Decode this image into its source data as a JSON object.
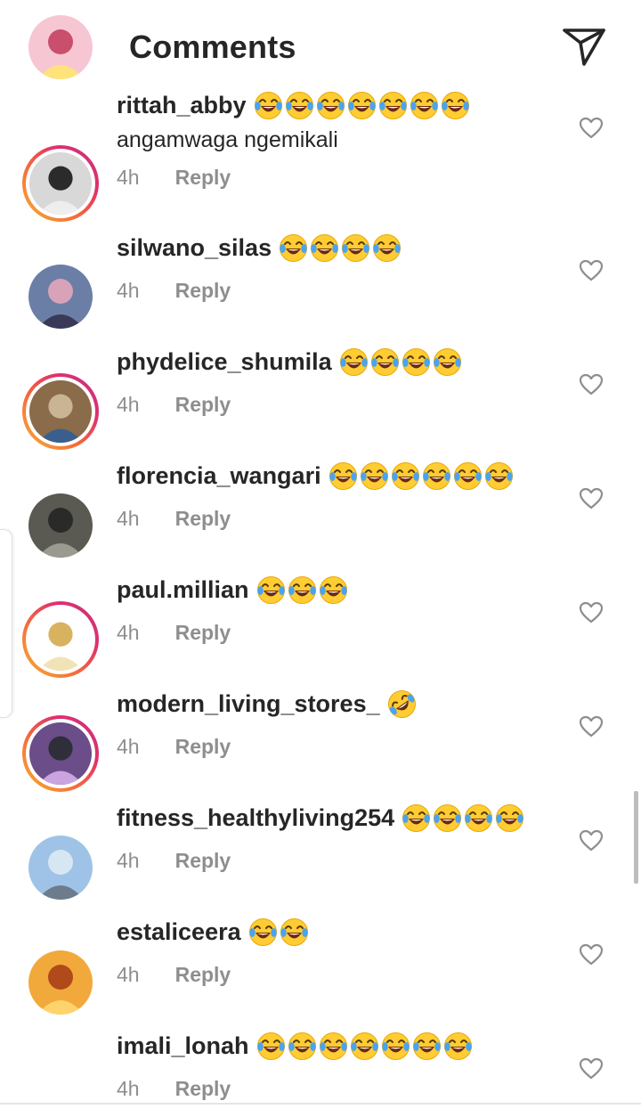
{
  "header": {
    "title": "Comments",
    "back_icon": "arrow-left-icon",
    "send_icon": "paper-plane-icon"
  },
  "comments": [
    {
      "username": "rittah_abby",
      "emoji": "😂",
      "emoji_count": 7,
      "text": "angamwaga ngemikali",
      "time": "4h",
      "reply": "Reply",
      "story_ring": false
    },
    {
      "username": "silwano_silas",
      "emoji": "😂",
      "emoji_count": 4,
      "text": "",
      "time": "4h",
      "reply": "Reply",
      "story_ring": true
    },
    {
      "username": "phydelice_shumila",
      "emoji": "😂",
      "emoji_count": 4,
      "text": "",
      "time": "4h",
      "reply": "Reply",
      "story_ring": false
    },
    {
      "username": "florencia_wangari",
      "emoji": "😂",
      "emoji_count": 6,
      "text": "",
      "time": "4h",
      "reply": "Reply",
      "story_ring": true
    },
    {
      "username": "paul.millian",
      "emoji": "😂",
      "emoji_count": 3,
      "text": "",
      "time": "4h",
      "reply": "Reply",
      "story_ring": false
    },
    {
      "username": "modern_living_stores_",
      "emoji": "🤣",
      "emoji_count": 1,
      "text": "",
      "time": "4h",
      "reply": "Reply",
      "story_ring": true
    },
    {
      "username": "fitness_healthyliving254",
      "emoji": "😂",
      "emoji_count": 4,
      "text": "",
      "time": "4h",
      "reply": "Reply",
      "story_ring": true
    },
    {
      "username": "estaliceera",
      "emoji": "😂",
      "emoji_count": 2,
      "text": "",
      "time": "4h",
      "reply": "Reply",
      "story_ring": false
    },
    {
      "username": "imali_lonah",
      "emoji": "😂",
      "emoji_count": 7,
      "text": "",
      "time": "4h",
      "reply": "Reply",
      "story_ring": false
    }
  ],
  "colors": {
    "text": "#262626",
    "muted": "#8e8e8e",
    "ring_start": "#f9b233",
    "ring_end": "#c13584"
  }
}
